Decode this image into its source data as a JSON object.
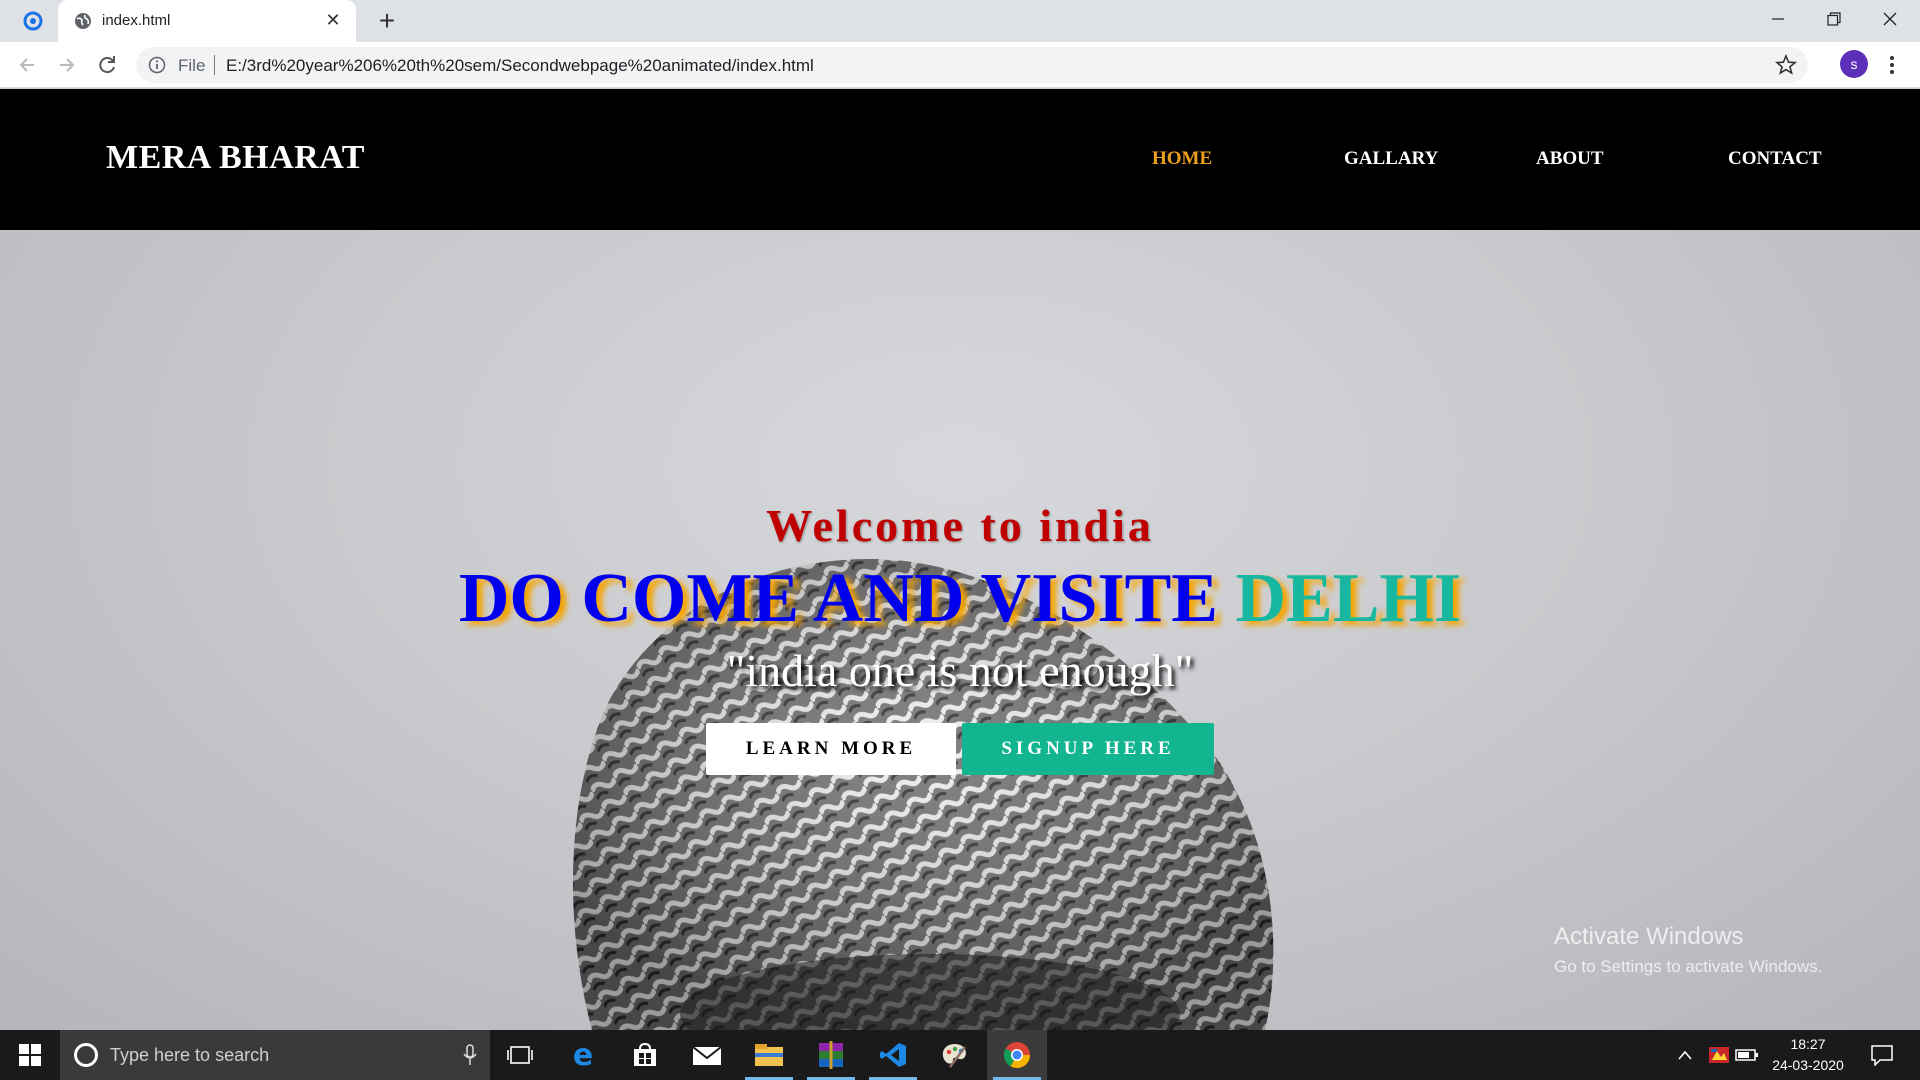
{
  "browser": {
    "tab_title": "index.html",
    "new_tab_label": "+",
    "omnibox_scheme": "File",
    "url": "E:/3rd%20year%206%20th%20sem/Secondwebpage%20animated/index.html",
    "profile_initial": "s"
  },
  "site": {
    "brand": "MERA BHARAT",
    "nav": [
      "HOME",
      "GALLARY",
      "ABOUT",
      "CONTACT"
    ],
    "active_nav": "HOME",
    "welcome": "Welcome to india",
    "headline_main": "DO COME AND VISITE ",
    "headline_accent": "DELHI",
    "tagline": "\"india one is not enough\"",
    "learn_more_label": "LEARN MORE",
    "signup_label": "SIGNUP HERE"
  },
  "watermark": {
    "line1": "Activate Windows",
    "line2": "Go to Settings to activate Windows."
  },
  "taskbar": {
    "search_placeholder": "Type here to search",
    "time": "18:27",
    "date": "24-03-2020",
    "pinned": [
      "task-view",
      "edge",
      "store",
      "mail",
      "file-explorer",
      "winrar",
      "vscode",
      "paint",
      "chrome"
    ]
  },
  "colors": {
    "nav_active": "#f0a020",
    "welcome": "#c00000",
    "headline": "#0000ee",
    "headline_accent": "#17b7a0",
    "headline_shadow": "#f5a400",
    "signup_button": "#13b490"
  }
}
